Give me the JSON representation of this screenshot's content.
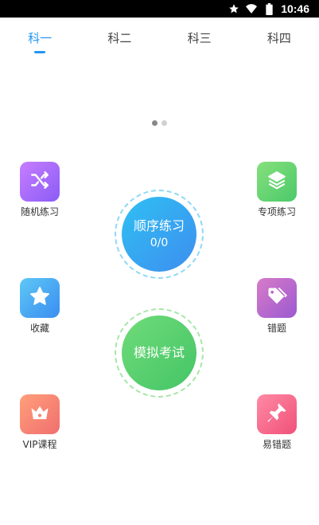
{
  "status_bar": {
    "time": "10:46",
    "icons": [
      "star-icon",
      "wifi-icon",
      "battery-icon"
    ]
  },
  "tabs": [
    {
      "label": "科一",
      "active": true
    },
    {
      "label": "科二",
      "active": false
    },
    {
      "label": "科三",
      "active": false
    },
    {
      "label": "科四",
      "active": false
    }
  ],
  "pager": {
    "pages": 2,
    "current": 1
  },
  "features": [
    {
      "label": "随机练习",
      "icon": "shuffle-icon",
      "gradient": [
        "#c77dff",
        "#8b5cf6"
      ]
    },
    {
      "label": "专项练习",
      "icon": "layers-icon",
      "gradient": [
        "#86e07c",
        "#4bc96a"
      ]
    },
    {
      "label": "收藏",
      "icon": "star-icon",
      "gradient": [
        "#5ec8f6",
        "#3a8df0"
      ]
    },
    {
      "label": "错题",
      "icon": "tag-icon",
      "gradient": [
        "#d77bc9",
        "#9b59d0"
      ]
    },
    {
      "label": "VIP课程",
      "icon": "crown-icon",
      "gradient": [
        "#ff9f7a",
        "#f06f6f"
      ]
    },
    {
      "label": "易错题",
      "icon": "pin-icon",
      "gradient": [
        "#ff8aa4",
        "#f0517a"
      ]
    }
  ],
  "sequential_practice": {
    "label": "顺序练习",
    "progress": "0/0",
    "gradient": [
      "#2fc0f2",
      "#3e8ef0"
    ],
    "ring": "#8fd8f5"
  },
  "mock_exam": {
    "label": "模拟考试",
    "gradient": [
      "#70db78",
      "#44c567"
    ],
    "ring": "#a8e6a8"
  }
}
